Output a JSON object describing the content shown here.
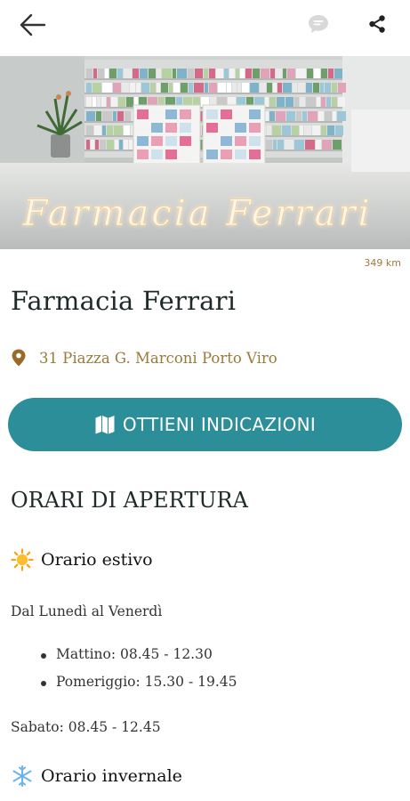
{
  "header": {
    "back_icon": "arrow-back-icon",
    "chat_icon": "chat-bubble-icon",
    "share_icon": "share-icon"
  },
  "hero": {
    "sign_text": "Farmacia Ferrari"
  },
  "distance": "349 km",
  "pharmacy": {
    "name": "Farmacia Ferrari",
    "address": "31 Piazza G. Marconi Porto Viro"
  },
  "directions_button": {
    "label": "OTTIENI INDICAZIONI",
    "icon": "map-icon"
  },
  "hours": {
    "section_title": "ORARI DI APERTURA",
    "summer": {
      "title": "Orario estivo",
      "icon": "sun-icon",
      "weekday_label": "Dal Lunedì al Venerdì",
      "morning": "Mattino:  08.45 - 12.30",
      "afternoon": "Pomeriggio: 15.30 - 19.45",
      "saturday": "Sabato: 08.45 - 12.45"
    },
    "winter": {
      "title": "Orario invernale",
      "icon": "snowflake-icon"
    }
  },
  "colors": {
    "accent": "#2c8e98",
    "address_gold": "#9a7a3a"
  }
}
